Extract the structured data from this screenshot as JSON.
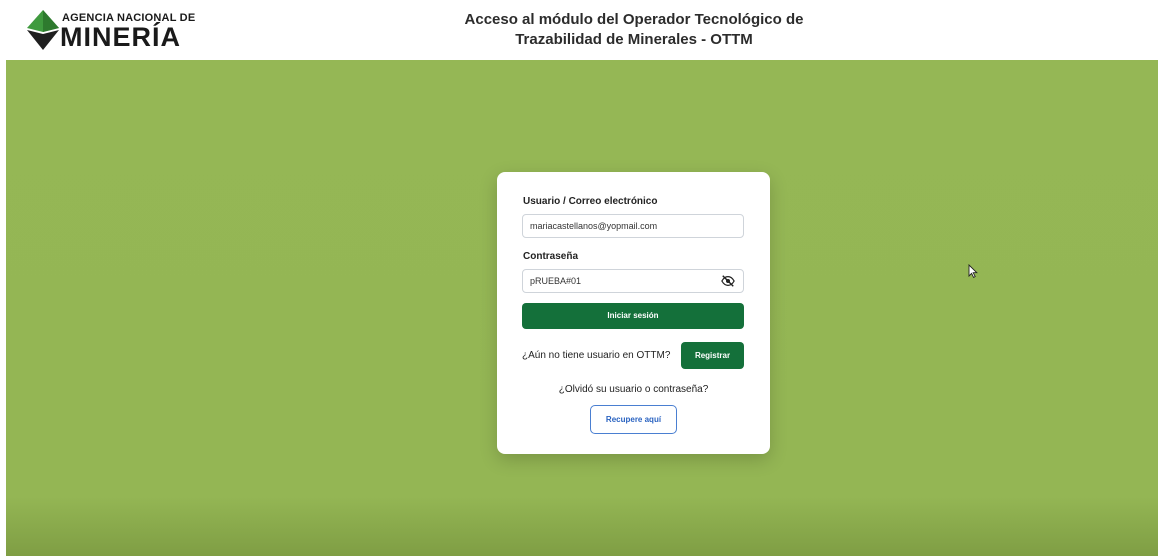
{
  "header": {
    "logo_top": "AGENCIA NACIONAL DE",
    "logo_main": "MINERÍA",
    "title_line1": "Acceso al módulo del Operador Tecnológico de",
    "title_line2": "Trazabilidad de Minerales - OTTM"
  },
  "login": {
    "user_label": "Usuario / Correo electrónico",
    "user_value": "mariacastellanos@yopmail.com",
    "password_label": "Contraseña",
    "password_value": "pRUEBA#01",
    "password_toggle_icon": "eye-slash-icon",
    "submit_label": "Iniciar sesión",
    "register_prompt": "¿Aún no tiene usuario en OTTM?",
    "register_label": "Registrar",
    "forgot_text": "¿Olvidó su usuario o contraseña?",
    "recover_label": "Recupere aquí"
  },
  "colors": {
    "background": "#95b755",
    "primary_button": "#14703a",
    "recover_border": "#4a7fd1",
    "logo_green": "#3f9a3e"
  }
}
